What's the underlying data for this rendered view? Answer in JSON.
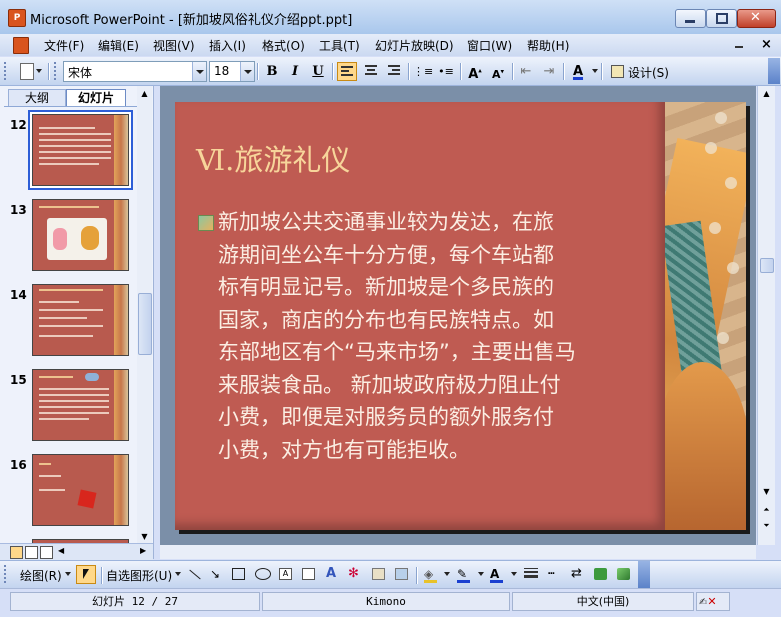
{
  "window": {
    "title": "Microsoft PowerPoint - [新加坡风俗礼仪介绍ppt.ppt]"
  },
  "menu": [
    "文件(F)",
    "编辑(E)",
    "视图(V)",
    "插入(I)",
    "格式(O)",
    "工具(T)",
    "幻灯片放映(D)",
    "窗口(W)",
    "帮助(H)"
  ],
  "toolbar": {
    "font_name": "宋体",
    "font_size": "18",
    "bold": "B",
    "italic": "I",
    "underline": "U",
    "design_label": "设计(S)",
    "font_color_label": "A"
  },
  "left_pane": {
    "tabs": [
      "大纲",
      "幻灯片"
    ],
    "selected_tab": "幻灯片",
    "thumbnails": [
      {
        "number": "12",
        "selected": true
      },
      {
        "number": "13",
        "selected": false
      },
      {
        "number": "14",
        "selected": false
      },
      {
        "number": "15",
        "selected": false
      },
      {
        "number": "16",
        "selected": false
      }
    ]
  },
  "slide": {
    "title": "Ⅵ.旅游礼仪",
    "body_lines": [
      "新加坡公共交通事业较为发达，在旅",
      "游期间坐公车十分方便，每个车站都",
      "标有明显记号。新加坡是个多民族的",
      "国家，商店的分布也有民族特点。如",
      "东部地区有个“马来市场”，主要出售马",
      "来服装食品。 新加坡政府极力阻止付",
      "小费，即便是对服务员的额外服务付",
      "小费，对方也有可能拒收。"
    ],
    "colors": {
      "background": "#bf5b52",
      "title": "#f7d59a",
      "body": "#fbeee3"
    }
  },
  "drawing_toolbar": {
    "draw_label": "绘图(R)",
    "autoshapes_label": "自选图形(U)"
  },
  "status": {
    "slide_number": "幻灯片 12 / 27",
    "design_template": "Kimono",
    "language": "中文(中国)"
  }
}
